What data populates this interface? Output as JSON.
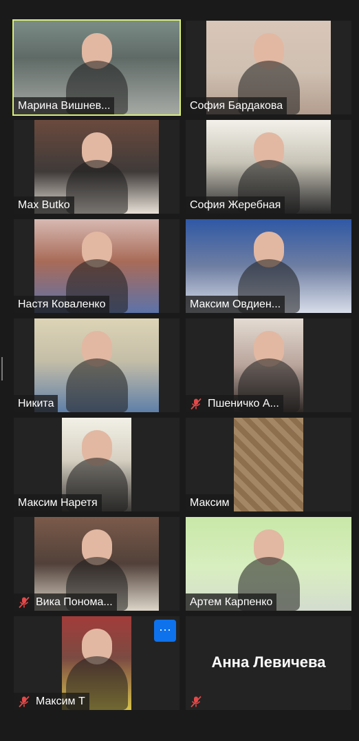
{
  "participants": [
    {
      "name": "Марина Вишнев...",
      "muted": false,
      "active": true
    },
    {
      "name": "София Бардакова",
      "muted": false
    },
    {
      "name": "Max Butko",
      "muted": false
    },
    {
      "name": "София Жеребная",
      "muted": false
    },
    {
      "name": "Настя Коваленко",
      "muted": false
    },
    {
      "name": "Максим Овдиен...",
      "muted": false
    },
    {
      "name": "Никита",
      "muted": false
    },
    {
      "name": "Пшеничко А...",
      "muted": true
    },
    {
      "name": "Максим Наретя",
      "muted": false
    },
    {
      "name": "Максим",
      "muted": false
    },
    {
      "name": "Вика Понома...",
      "muted": true
    },
    {
      "name": "Артем  Карпенко",
      "muted": false
    },
    {
      "name": "Максим Т",
      "muted": true,
      "more_button": "···"
    },
    {
      "name": "Анна Левичева",
      "muted": true,
      "video_off": true
    }
  ],
  "colors": {
    "active_border": "#d9ef79",
    "mute_icon": "#e54848",
    "more_button": "#0e72ed"
  }
}
